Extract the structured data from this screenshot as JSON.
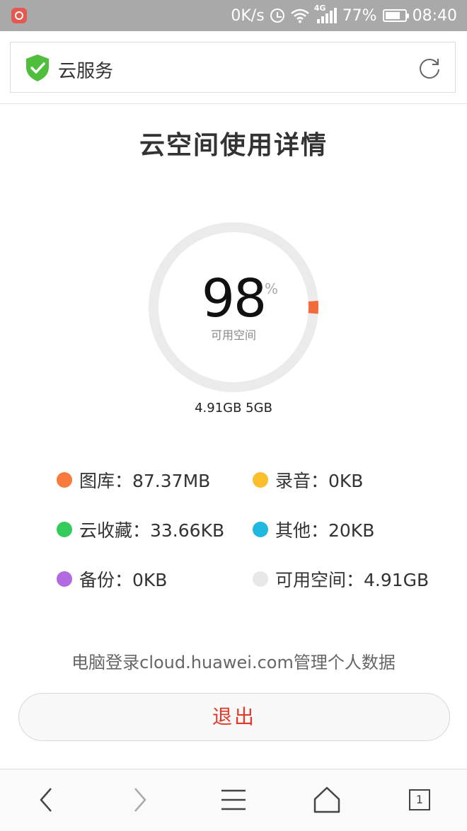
{
  "status_bar": {
    "net_speed": "0K/s",
    "network_type": "4G",
    "battery_percent": "77%",
    "battery_level": 0.77,
    "time": "08:40",
    "icons": [
      "app-icon",
      "alarm-icon",
      "wifi-icon",
      "signal-icon",
      "battery-icon"
    ]
  },
  "header": {
    "title": "云服务",
    "icons": [
      "shield-check-icon",
      "refresh-icon"
    ]
  },
  "page": {
    "title": "云空间使用详情"
  },
  "gauge": {
    "value": "98",
    "unit": "%",
    "label": "可用空间",
    "available": "4.91GB",
    "total": "5GB",
    "available_fraction": 0.98,
    "used_color": "#f26b3a",
    "track_color": "#ebebeb"
  },
  "legend": [
    {
      "label": "图库：87.37MB",
      "color": "#f97b3c"
    },
    {
      "label": "录音：0KB",
      "color": "#fbbf2c"
    },
    {
      "label": "云收藏：33.66KB",
      "color": "#33cc5a"
    },
    {
      "label": "其他：20KB",
      "color": "#1fb8e0"
    },
    {
      "label": "备份：0KB",
      "color": "#b26ae0"
    },
    {
      "label": "可用空间：4.91GB",
      "color": "#e8e8e8"
    }
  ],
  "hint": "电脑登录cloud.huawei.com管理个人数据",
  "logout_label": "退出",
  "nav": {
    "tab_count": "1",
    "icons": [
      "back-icon",
      "forward-icon",
      "menu-icon",
      "home-icon",
      "tabs-icon"
    ]
  }
}
